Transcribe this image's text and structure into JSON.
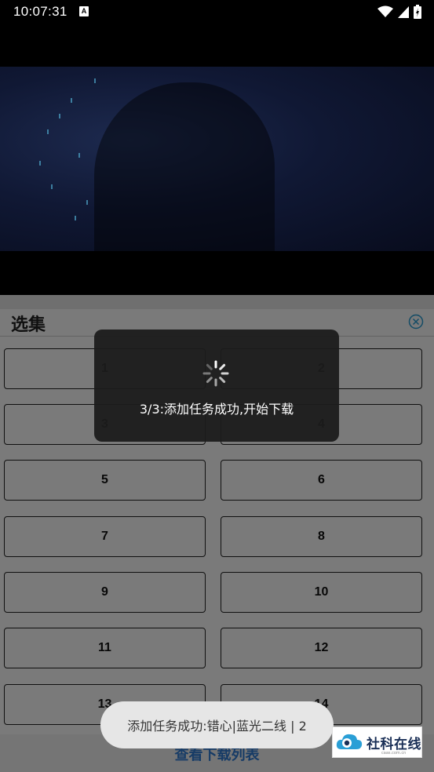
{
  "status_bar": {
    "time": "10:07:31",
    "indicator": "A",
    "icons": [
      "wifi-icon",
      "signal-icon",
      "battery-icon"
    ]
  },
  "sheet": {
    "title": "选集",
    "episodes": [
      "1",
      "2",
      "3",
      "4",
      "5",
      "6",
      "7",
      "8",
      "9",
      "10",
      "11",
      "12",
      "13",
      "14"
    ],
    "download_link": "查看下载列表"
  },
  "loading_dialog": {
    "message": "3/3:添加任务成功,开始下载"
  },
  "toast": {
    "message": "添加任务成功:错心|蓝光二线 | 2"
  },
  "watermark": {
    "name": "社科在线",
    "url": "caas.com.cn"
  },
  "colors": {
    "accent": "#2e7cd6",
    "close_icon": "#2a9fd6",
    "overlay": "rgba(0,0,0,0.52)"
  }
}
